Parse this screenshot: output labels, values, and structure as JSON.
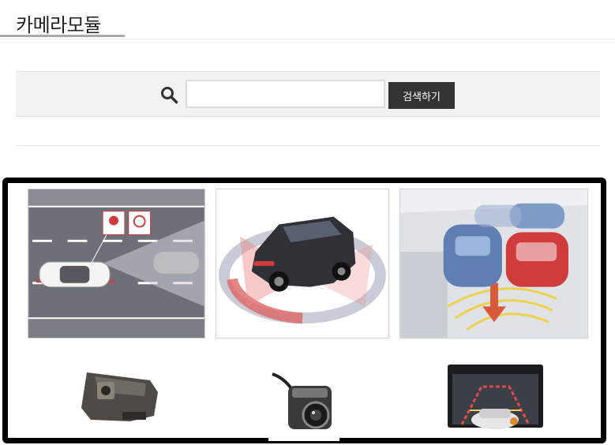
{
  "page": {
    "title": "카메라모듈"
  },
  "search": {
    "placeholder": "",
    "value": "",
    "button_label": "검색하기"
  },
  "gallery": {
    "items": [
      {
        "icon": "lane-warning-illustration"
      },
      {
        "icon": "suv-360-view-illustration"
      },
      {
        "icon": "parking-assist-illustration"
      },
      {
        "icon": "camera-module-bracket"
      },
      {
        "icon": "rear-view-camera"
      },
      {
        "icon": "parking-monitor-display"
      }
    ]
  }
}
